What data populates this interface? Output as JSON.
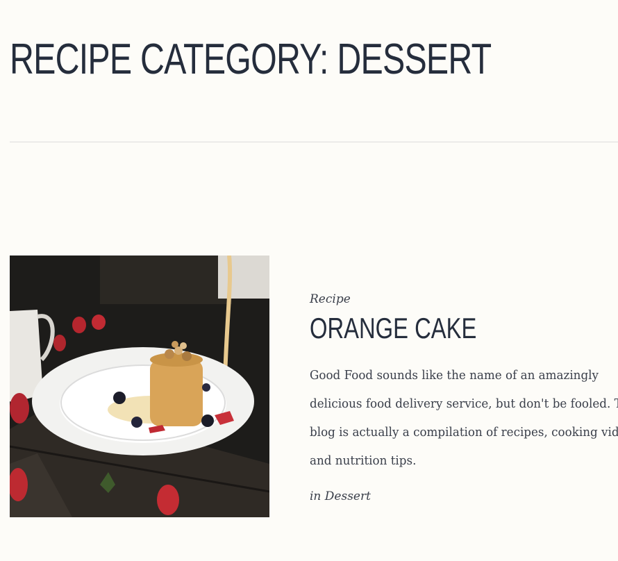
{
  "archive": {
    "title": "RECIPE CATEGORY: DESSERT"
  },
  "posts": [
    {
      "kicker": "Recipe",
      "title": "ORANGE CAKE",
      "excerpt_lines": [
        "Good Food sounds like the name of an amazingly",
        "delicious food delivery service, but don't be fooled. The",
        "blog is actually a compilation of recipes, cooking videos,",
        "and nutrition tips."
      ],
      "meta_prefix": "in ",
      "category": "Dessert",
      "image_icon": "plated-cake-photo"
    }
  ],
  "colors": {
    "background": "#fdfcf8",
    "heading": "#252d3c",
    "body_text": "#3a3f4a",
    "divider": "#dcdcdc"
  }
}
